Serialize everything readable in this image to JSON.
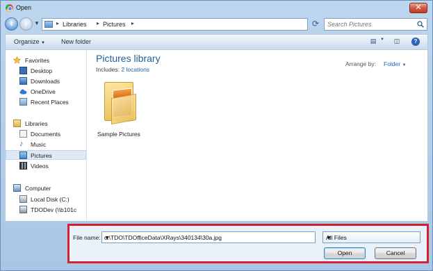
{
  "window": {
    "title": "Open",
    "close_glyph": "✕"
  },
  "address": {
    "crumbs": [
      "Libraries",
      "Pictures"
    ],
    "search_placeholder": "Search Pictures"
  },
  "toolbar": {
    "organize": "Organize",
    "new_folder": "New folder"
  },
  "sidebar": {
    "favorites_header": "Favorites",
    "favorites": [
      "Desktop",
      "Downloads",
      "OneDrive",
      "Recent Places"
    ],
    "libraries_header": "Libraries",
    "libraries": [
      "Documents",
      "Music",
      "Pictures",
      "Videos"
    ],
    "computer_header": "Computer",
    "computer": [
      "Local Disk (C:)",
      "TDODev (\\\\b101c"
    ],
    "selected": "Pictures"
  },
  "main": {
    "title": "Pictures library",
    "includes_label": "Includes:",
    "includes_link": "2 locations",
    "arrange_label": "Arrange by:",
    "arrange_value": "Folder",
    "items": [
      {
        "name": "Sample Pictures",
        "icon": "picture-folder-icon"
      }
    ]
  },
  "bottom": {
    "filename_label": "File name:",
    "filename_value": "c:\\TDO\\TDOfficeData\\XRays\\340134\\30a.jpg",
    "filetype_value": "All Files",
    "open_label": "Open",
    "cancel_label": "Cancel",
    "highlight_color": "#d3202a"
  }
}
